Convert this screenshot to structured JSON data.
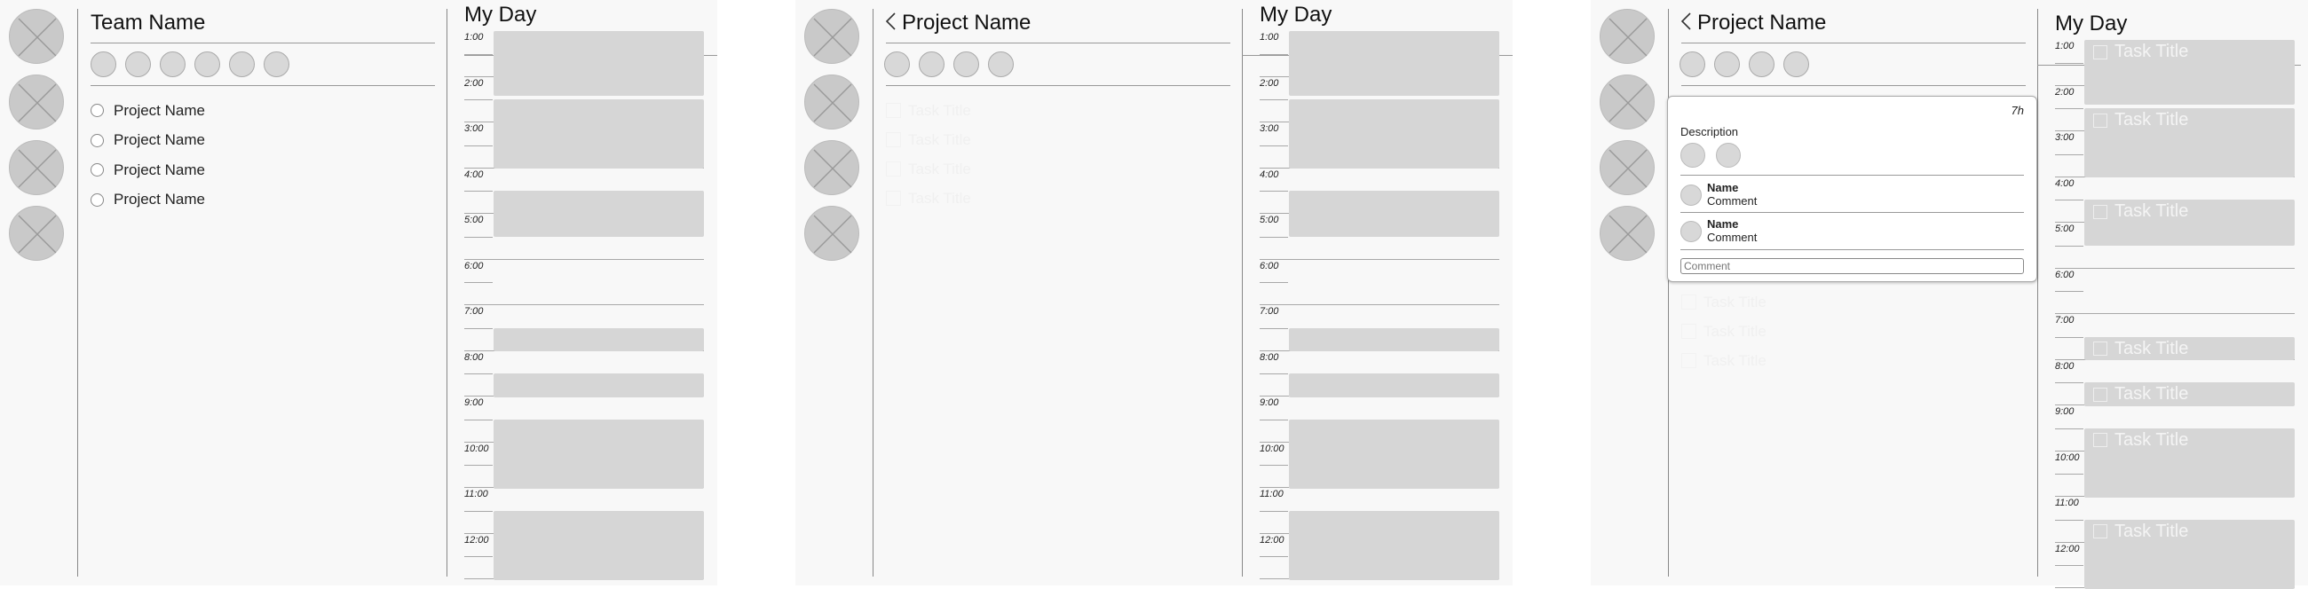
{
  "frame1": {
    "title": "Team Name",
    "projects": [
      "Project Name",
      "Project Name",
      "Project Name",
      "Project Name"
    ]
  },
  "frame2": {
    "title": "Project Name",
    "faded_tasks": [
      "Task Title",
      "Task Title",
      "Task Title",
      "Task Title"
    ]
  },
  "frame3": {
    "title": "Project Name",
    "faded_tasks": [
      "Task Title",
      "Task Title",
      "Task Title"
    ],
    "popup": {
      "duration": "7h",
      "description": "Description",
      "comments": [
        {
          "name": "Name",
          "text": "Comment"
        },
        {
          "name": "Name",
          "text": "Comment"
        }
      ],
      "comment_placeholder": "Comment"
    },
    "task_titles": [
      "Task Title",
      "Task Title",
      "Task Title",
      "Task Title",
      "Task Title",
      "Task Title",
      "Task Title"
    ]
  },
  "my_day": {
    "title": "My Day",
    "hours": [
      "1:00",
      "2:00",
      "3:00",
      "4:00",
      "5:00",
      "6:00",
      "7:00",
      "8:00",
      "9:00",
      "10:00",
      "11:00",
      "12:00"
    ]
  },
  "colors": {
    "frame_bg": "#f8f8f8",
    "block": "#d6d6d6",
    "avatar": "#c9c9c9"
  }
}
